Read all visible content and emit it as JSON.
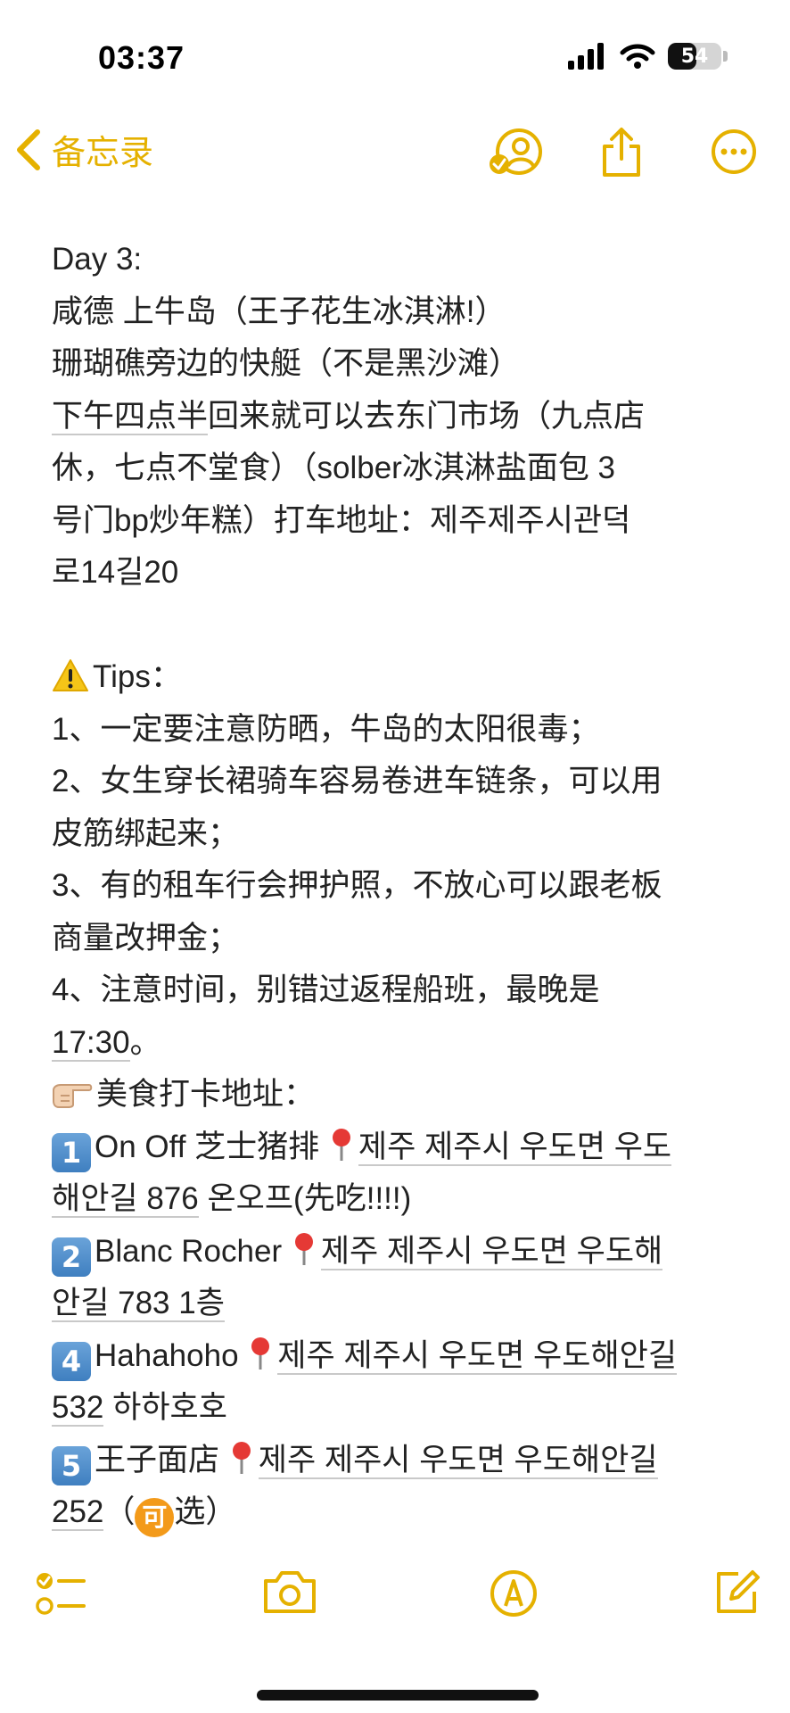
{
  "status": {
    "time": "03:37",
    "battery": "54",
    "battery_level": 0.54
  },
  "nav": {
    "back_label": "备忘录",
    "icons": [
      "collaborate-icon",
      "share-icon",
      "more-icon"
    ]
  },
  "colors": {
    "accent": "#e5b100",
    "keycap": "#3f7fc0",
    "link_underline": "#c9c9c9"
  },
  "note": {
    "l1": "Day 3:",
    "l2": "咸德 上牛岛（王子花生冰淇淋!）",
    "l3": "珊瑚礁旁边的快艇（不是黑沙滩）",
    "l4_link": "下午四点半",
    "l4_rest": "回来就可以去东门市场（九点店",
    "l5": "休，七点不堂食）（solber冰淇淋盐面包 3",
    "l6": "号门bp炒年糕）打车地址：제주제주시관덕",
    "l7": "로14길20",
    "tips_title": "Tips：",
    "tip1": "1、一定要注意防晒，牛岛的太阳很毒；",
    "tip2a": "2、女生穿长裙骑车容易卷进车链条，可以用",
    "tip2b": "皮筋绑起来；",
    "tip3a": "3、有的租车行会押护照，不放心可以跟老板",
    "tip3b": "商量改押金；",
    "tip4a": "4、注意时间，别错过返程船班，最晚是",
    "tip4b_link": "17:30",
    "tip4b_rest": "。",
    "food_title": "美食打卡地址：",
    "f1_key": "1",
    "f1_name": "On Off 芝士猪排",
    "f1_addr1": "제주 제주시 우도면 우도",
    "f1_addr2": "해안길 876",
    "f1_rest": " 온오프(先吃!!!!)",
    "f2_key": "2",
    "f2_name": "Blanc Rocher",
    "f2_addr1": "제주 제주시 우도면 우도해",
    "f2_addr2": "안길 783 1층",
    "f4_key": "4",
    "f4_name": "Hahahoho",
    "f4_addr1": "제주 제주시 우도면 우도해안길",
    "f4_addr2": "532",
    "f4_rest": " 하하호호",
    "f5_key": "5",
    "f5_name": "王子面店",
    "f5_addr1": "제주 제주시 우도면 우도해안길",
    "f5_addr2": "252",
    "f5_open": "（",
    "f5_badge": "可",
    "f5_close": "选）"
  },
  "toolbar": {
    "icons": [
      "checklist-icon",
      "camera-icon",
      "markup-icon",
      "compose-icon"
    ]
  }
}
